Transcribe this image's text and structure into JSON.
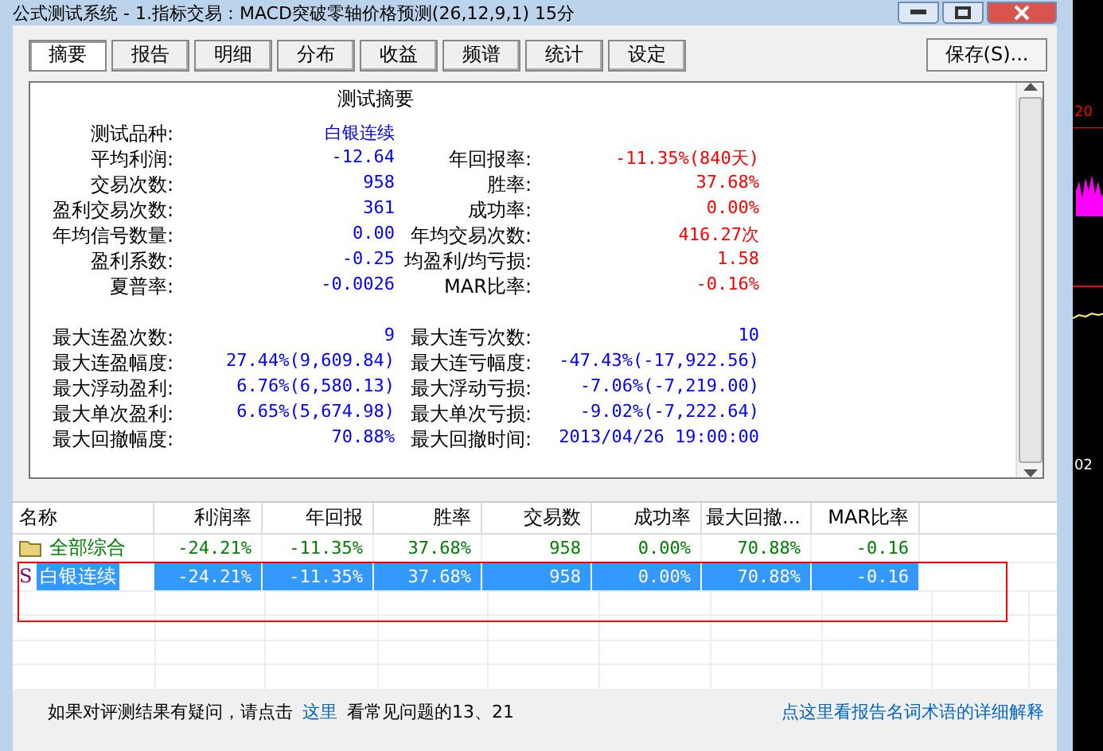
{
  "window": {
    "title": "公式测试系统 - 1.指标交易：MACD突破零轴价格预测(26,12,9,1) 15分"
  },
  "tabs": [
    {
      "label": "摘要",
      "selected": true
    },
    {
      "label": "报告",
      "selected": false
    },
    {
      "label": "明细",
      "selected": false
    },
    {
      "label": "分布",
      "selected": false
    },
    {
      "label": "收益",
      "selected": false
    },
    {
      "label": "频谱",
      "selected": false
    },
    {
      "label": "统计",
      "selected": false
    },
    {
      "label": "设定",
      "selected": false
    }
  ],
  "save_button": "保存(S)...",
  "summary": {
    "title": "测试摘要",
    "sections": [
      {
        "rows": [
          {
            "label": "测试品种:",
            "value": "白银连续"
          },
          {
            "label": "平均利润:",
            "value": "-12.64",
            "right_label": "年回报率:",
            "right_value": "-11.35%(840天)",
            "color": "#ff0000"
          },
          {
            "label": "交易次数:",
            "value": "958",
            "right_label": "胜率:",
            "right_value": "37.68%",
            "color": "#ff0000"
          },
          {
            "label": "盈利交易次数:",
            "value": "361",
            "right_label": "成功率:",
            "right_value": "0.00%",
            "color": "#ff0000"
          },
          {
            "label": "年均信号数量:",
            "value": "0.00",
            "right_label": "年均交易次数:",
            "right_value": "416.27次",
            "color": "#ff0000"
          },
          {
            "label": "盈利系数:",
            "value": "-0.25",
            "right_label": "均盈利/均亏损:",
            "right_value": "1.58",
            "color": "#ff0000"
          },
          {
            "label": "夏普率:",
            "value": "-0.0026",
            "right_label": "MAR比率:",
            "right_value": "-0.16%",
            "color": "#ff0000"
          }
        ]
      },
      {
        "rows": [
          {
            "label": "最大连盈次数:",
            "value": "9",
            "right_label": "最大连亏次数:",
            "right_value": "10",
            "color": "#0000ff"
          },
          {
            "label": "最大连盈幅度:",
            "value": "27.44%(9,609.84)",
            "right_label": "最大连亏幅度:",
            "right_value": "-47.43%(-17,922.56)",
            "color": "#0000ff"
          },
          {
            "label": "最大浮动盈利:",
            "value": "6.76%(6,580.13)",
            "right_label": "最大浮动亏损:",
            "right_value": "-7.06%(-7,219.00)",
            "color": "#0000ff"
          },
          {
            "label": "最大单次盈利:",
            "value": "6.65%(5,674.98)",
            "right_label": "最大单次亏损:",
            "right_value": "-9.02%(-7,222.64)",
            "color": "#0000ff"
          },
          {
            "label": "最大回撤幅度:",
            "value": "70.88%",
            "right_label": "最大回撤时间:",
            "right_value": "2013/04/26 19:00:00",
            "color": "#0000ff"
          }
        ]
      }
    ]
  },
  "table": {
    "columns": [
      "名称",
      "利润率",
      "年回报",
      "胜率",
      "交易数",
      "成功率",
      "最大回撤...",
      "MAR比率"
    ],
    "rows": [
      {
        "kind": "group",
        "selected": false,
        "cells": [
          "全部综合",
          "-24.21%",
          "-11.35%",
          "37.68%",
          "958",
          "0.00%",
          "70.88%",
          "-0.16"
        ]
      },
      {
        "kind": "symbol",
        "selected": true,
        "icon_letter": "S",
        "cells": [
          "白银连续",
          "-24.21%",
          "-11.35%",
          "37.68%",
          "958",
          "0.00%",
          "70.88%",
          "-0.16"
        ]
      }
    ]
  },
  "footer": {
    "text": "如果对评测结果有疑问，请点击",
    "link": "这里",
    "text_2": "看常见问题的13、21",
    "link_2": "点这里看报告名词术语的详细解释"
  },
  "side_chart": {
    "labels": [
      "20",
      "02"
    ]
  }
}
